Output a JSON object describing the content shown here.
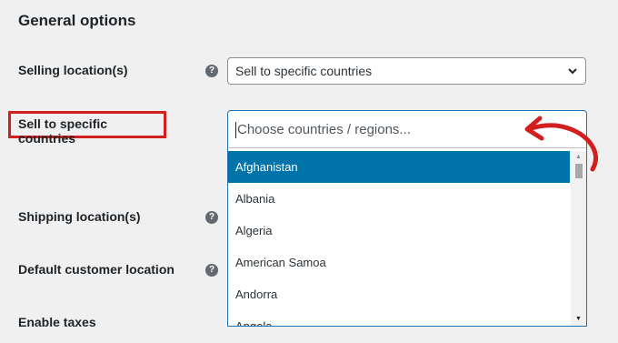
{
  "section": {
    "title": "General options"
  },
  "selling_location": {
    "label": "Selling location(s)",
    "help": "?",
    "value": "Sell to specific countries"
  },
  "specific_countries": {
    "label": "Sell to specific countries",
    "placeholder": "Choose countries / regions...",
    "options": [
      "Afghanistan",
      "Albania",
      "Algeria",
      "American Samoa",
      "Andorra",
      "Angola"
    ],
    "active_option": "Afghanistan",
    "scroll_up": "▲",
    "scroll_down": "▼"
  },
  "shipping_location": {
    "label": "Shipping location(s)",
    "help": "?"
  },
  "default_customer_location": {
    "label": "Default customer location",
    "help": "?"
  },
  "enable_taxes": {
    "label": "Enable taxes"
  },
  "colors": {
    "highlight": "#d21f1f",
    "active_option": "#0073aa",
    "focus_border": "#2271b1"
  }
}
